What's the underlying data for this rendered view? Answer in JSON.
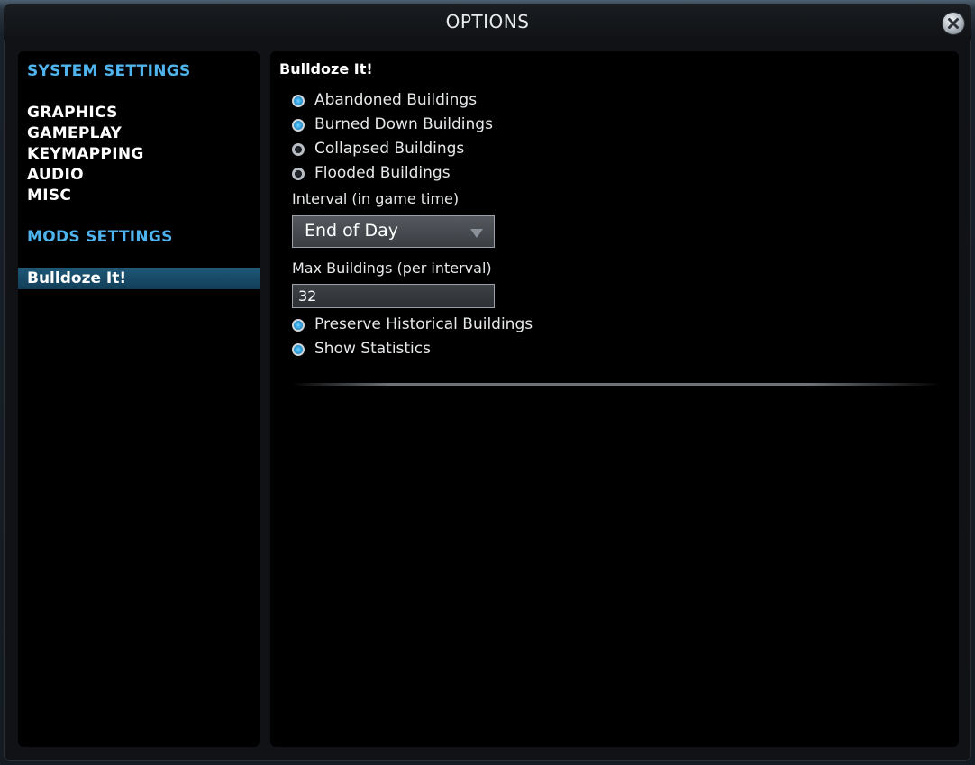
{
  "window": {
    "title": "OPTIONS"
  },
  "sidebar": {
    "system_settings_title": "SYSTEM SETTINGS",
    "system_items": [
      {
        "label": "GRAPHICS"
      },
      {
        "label": "GAMEPLAY"
      },
      {
        "label": "KEYMAPPING"
      },
      {
        "label": "AUDIO"
      },
      {
        "label": "MISC"
      }
    ],
    "mods_settings_title": "MODS SETTINGS",
    "mod_items": [
      {
        "label": "Bulldoze It!",
        "selected": true
      }
    ]
  },
  "content": {
    "title": "Bulldoze It!",
    "options": [
      {
        "label": "Abandoned Buildings",
        "checked": true
      },
      {
        "label": "Burned Down Buildings",
        "checked": true
      },
      {
        "label": "Collapsed Buildings",
        "checked": false
      },
      {
        "label": "Flooded Buildings",
        "checked": false
      }
    ],
    "interval": {
      "label": "Interval (in game time)",
      "selected": "End of Day"
    },
    "max_buildings": {
      "label": "Max Buildings (per interval)",
      "value": "32"
    },
    "extra_options": [
      {
        "label": "Preserve Historical Buildings",
        "checked": true
      },
      {
        "label": "Show Statistics",
        "checked": true
      }
    ]
  },
  "colors": {
    "accent": "#4fb3ee",
    "selected_item_bg": "#1a4e6e"
  },
  "icons": {
    "close": "close-icon",
    "dropdown": "chevron-down-icon"
  }
}
